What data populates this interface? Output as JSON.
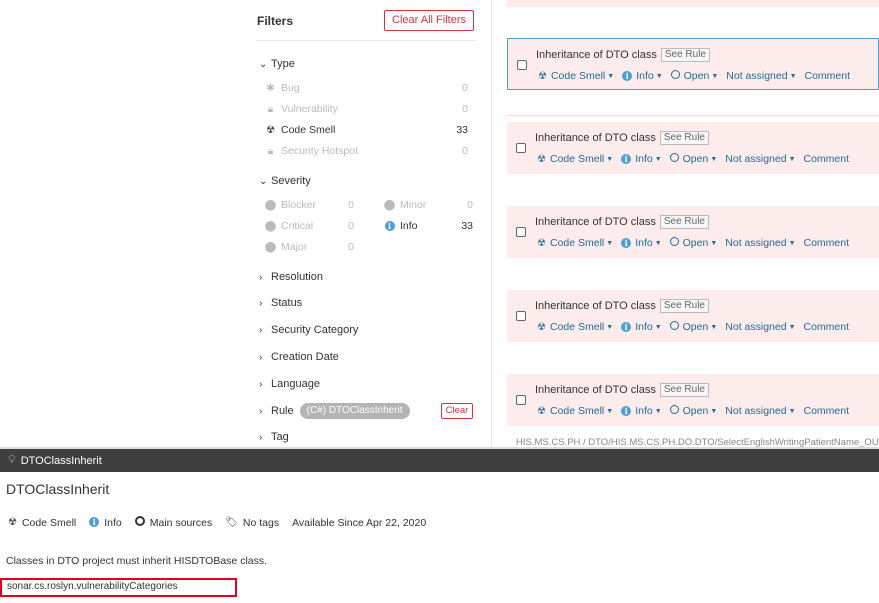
{
  "filters": {
    "title": "Filters",
    "clear_all": "Clear All Filters",
    "type": {
      "label": "Type",
      "items": [
        {
          "label": "Bug",
          "count": "0",
          "icon": "bug-icon"
        },
        {
          "label": "Vulnerability",
          "count": "0",
          "icon": "lock-icon"
        },
        {
          "label": "Code Smell",
          "count": "33",
          "icon": "radiation-icon"
        },
        {
          "label": "Security Hotspot",
          "count": "0",
          "icon": "lock-icon"
        }
      ]
    },
    "severity": {
      "label": "Severity",
      "items": [
        {
          "label": "Blocker",
          "count": "0"
        },
        {
          "label": "Minor",
          "count": "0"
        },
        {
          "label": "Critical",
          "count": "0"
        },
        {
          "label": "Info",
          "count": "33"
        },
        {
          "label": "Major",
          "count": "0"
        }
      ]
    },
    "collapsed": [
      "Resolution",
      "Status",
      "Security Category",
      "Creation Date",
      "Language"
    ],
    "rule": {
      "label": "Rule",
      "value": "(C#) DTOClassInherit",
      "clear": "Clear"
    },
    "tag": "Tag"
  },
  "issues": [
    {
      "title": "Inheritance of DTO class",
      "see_rule": "See Rule",
      "type": "Code Smell",
      "severity": "Info",
      "status": "Open",
      "assignee": "Not assigned",
      "comment": "Comment"
    },
    {
      "title": "Inheritance of DTO class",
      "see_rule": "See Rule",
      "type": "Code Smell",
      "severity": "Info",
      "status": "Open",
      "assignee": "Not assigned",
      "comment": "Comment"
    },
    {
      "title": "Inheritance of DTO class",
      "see_rule": "See Rule",
      "type": "Code Smell",
      "severity": "Info",
      "status": "Open",
      "assignee": "Not assigned",
      "comment": "Comment"
    },
    {
      "title": "Inheritance of DTO class",
      "see_rule": "See Rule",
      "type": "Code Smell",
      "severity": "Info",
      "status": "Open",
      "assignee": "Not assigned",
      "comment": "Comment"
    },
    {
      "title": "Inheritance of DTO class",
      "see_rule": "See Rule",
      "type": "Code Smell",
      "severity": "Info",
      "status": "Open",
      "assignee": "Not assigned",
      "comment": "Comment"
    }
  ],
  "file_path": "HIS.MS.CS.PH  /  DTO/HIS.MS.CS.PH.DO.DTO/SelectEnglishWritingPatientName_OU",
  "panel": {
    "header_title": "DTOClassInherit",
    "rule_name": "DTOClassInherit",
    "meta": {
      "type": "Code Smell",
      "severity": "Info",
      "scope": "Main sources",
      "tags": "No tags",
      "available": "Available Since Apr 22, 2020"
    },
    "description": "Classes in DTO project must inherit HISDTOBase class.",
    "rule_key": "sonar.cs.roslyn.vulnerabilityCategories"
  },
  "colors": {
    "accent_red": "#d4333f",
    "issue_bg": "#fdecec",
    "link_blue": "#236a97",
    "selected_border": "#4b9fd5",
    "header_dark": "#3f3f3f"
  }
}
